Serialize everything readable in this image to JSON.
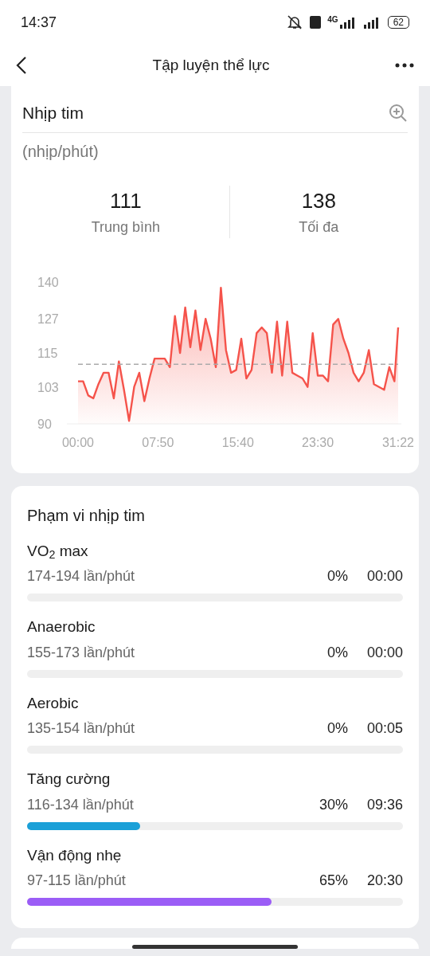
{
  "status_bar": {
    "time": "14:37",
    "network": "4G",
    "battery": "62"
  },
  "header": {
    "title": "Tập luyện thể lực"
  },
  "heart_rate": {
    "title": "Nhịp tim",
    "unit": "(nhịp/phút)",
    "stats": [
      {
        "value": "111",
        "label": "Trung bình"
      },
      {
        "value": "138",
        "label": "Tối đa"
      }
    ],
    "chart_data": {
      "type": "area",
      "x": [
        0,
        0.5,
        1,
        1.5,
        2,
        2.5,
        3,
        3.5,
        4,
        4.5,
        5,
        5.5,
        6,
        6.5,
        7,
        7.5,
        8,
        8.5,
        9,
        9.5,
        10,
        10.5,
        11,
        11.5,
        12,
        12.5,
        13,
        13.5,
        14,
        14.5,
        15,
        15.5,
        16,
        16.5,
        17,
        17.5,
        18,
        18.5,
        19,
        19.5,
        20,
        20.5,
        21,
        21.5,
        22,
        22.5,
        23,
        23.5,
        24,
        24.5,
        25,
        25.5,
        26,
        26.5,
        27,
        27.5,
        28,
        28.5,
        29,
        29.5,
        30,
        30.5,
        31,
        31.37
      ],
      "series": [
        {
          "color": "#f5534b",
          "values": [
            105,
            105,
            100,
            99,
            104,
            108,
            108,
            99,
            112,
            102,
            91,
            103,
            108,
            98,
            106,
            113,
            113,
            113,
            110,
            128,
            115,
            131,
            117,
            130,
            116,
            127,
            120,
            110,
            138,
            116,
            108,
            109,
            120,
            106,
            109,
            122,
            124,
            122,
            108,
            126,
            107,
            126,
            108,
            107,
            106,
            103,
            122,
            107,
            107,
            105,
            125,
            127,
            120,
            115,
            108,
            105,
            108,
            116,
            104,
            103,
            102,
            110,
            105,
            124
          ]
        }
      ],
      "xlim": [
        0,
        31.37
      ],
      "ylim": [
        90,
        140
      ],
      "yticks": [
        90,
        103,
        115,
        127,
        140
      ],
      "xticks": [
        {
          "value": 0,
          "label": "00:00"
        },
        {
          "value": 7.833,
          "label": "07:50"
        },
        {
          "value": 15.667,
          "label": "15:40"
        },
        {
          "value": 23.5,
          "label": "23:30"
        },
        {
          "value": 31.37,
          "label": "31:22"
        }
      ],
      "ref_lines": [
        {
          "axis": "y",
          "value": 111
        }
      ]
    }
  },
  "zones": {
    "title": "Phạm vi nhịp tim",
    "items": [
      {
        "name": "VO$_{2}$ max",
        "range": "174-194 lần/phút",
        "percent": "0%",
        "duration": "00:00"
      },
      {
        "name": "Anaerobic",
        "range": "155-173 lần/phút",
        "percent": "0%",
        "duration": "00:00"
      },
      {
        "name": "Aerobic",
        "range": "135-154 lần/phút",
        "percent": "0%",
        "duration": "00:05"
      },
      {
        "name": "Tăng cường",
        "range": "116-134 lần/phút",
        "percent": "30%",
        "duration": "09:36",
        "level": 0.3,
        "color": "#1ba0d8"
      },
      {
        "name": "Vận động nhẹ",
        "range": "97-115 lần/phút",
        "percent": "65%",
        "duration": "20:30",
        "level": 0.65,
        "color": "#9b5df6"
      }
    ]
  }
}
